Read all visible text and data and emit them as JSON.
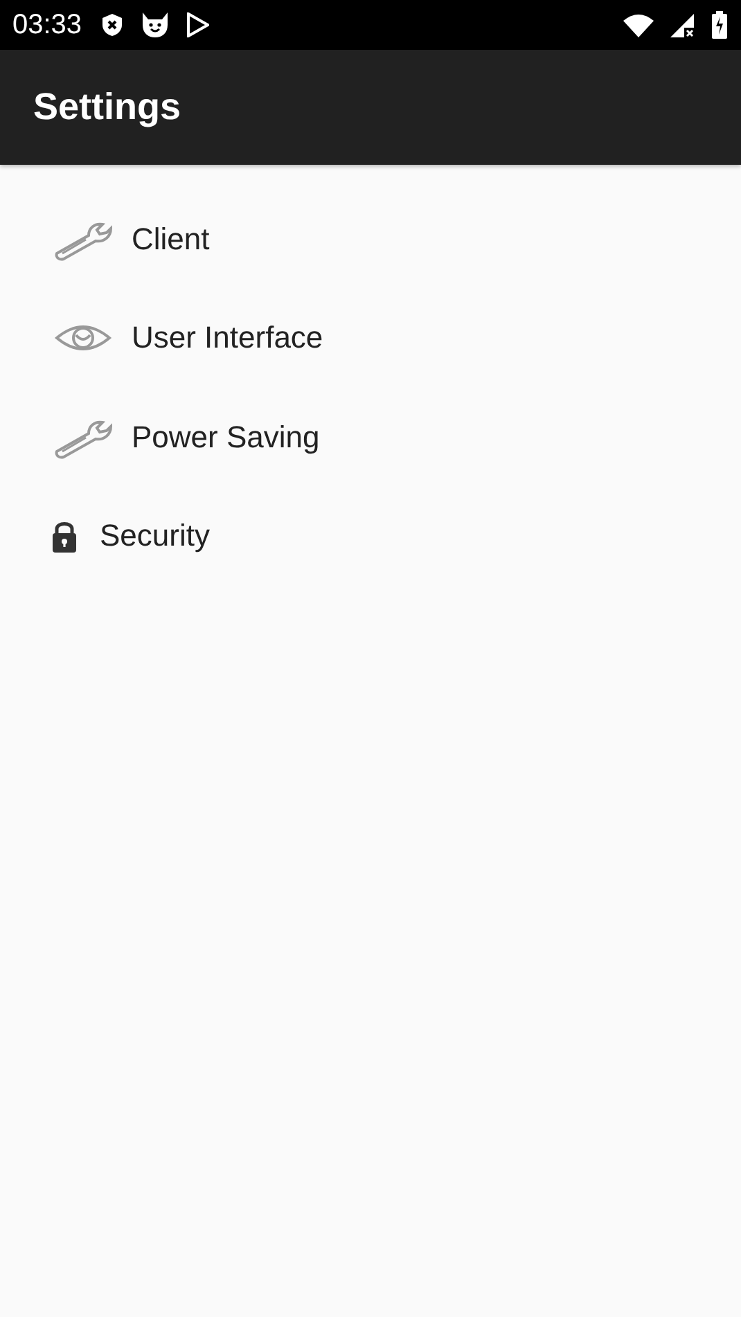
{
  "status_bar": {
    "time": "03:33"
  },
  "app_bar": {
    "title": "Settings"
  },
  "items": [
    {
      "label": "Client",
      "kind": "wrench"
    },
    {
      "label": "User Interface",
      "kind": "eye"
    },
    {
      "label": "Power Saving",
      "kind": "wrench"
    },
    {
      "label": "Security",
      "kind": "lock"
    }
  ]
}
